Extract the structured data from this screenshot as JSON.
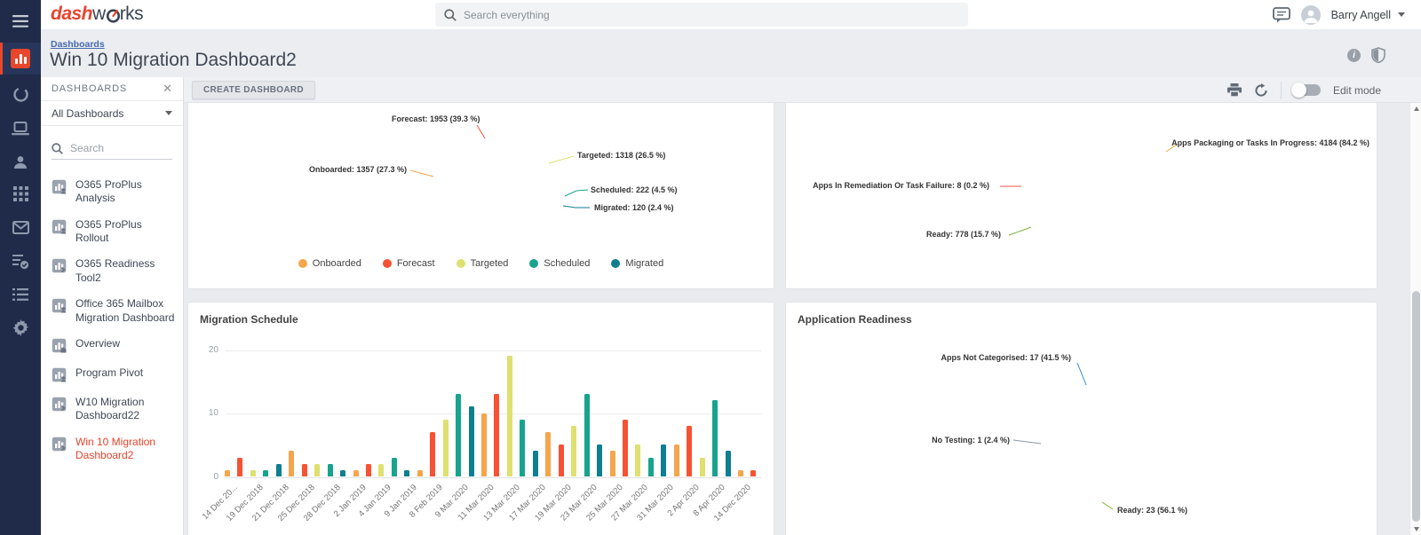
{
  "topbar": {
    "brand_prefix": "dash",
    "brand_mid": "w",
    "brand_suffix": "rks",
    "search_placeholder": "Search everything",
    "user_name": "Barry Angell"
  },
  "header": {
    "breadcrumb": "Dashboards",
    "title": "Win 10 Migration Dashboard2"
  },
  "toolbar": {
    "create_button": "CREATE DASHBOARD",
    "edit_mode_label": "Edit mode"
  },
  "dash_panel": {
    "title": "DASHBOARDS",
    "filter_label": "All Dashboards",
    "search_placeholder": "Search",
    "items": [
      {
        "label": "O365 ProPlus Analysis",
        "icon": "dashboard-user",
        "selected": false
      },
      {
        "label": "O365 ProPlus Rollout",
        "icon": "dashboard-user",
        "selected": false
      },
      {
        "label": "O365 Readiness Tool2",
        "icon": "dashboard-share",
        "selected": false
      },
      {
        "label": "Office 365 Mailbox Migration Dashboard",
        "icon": "dashboard-user",
        "selected": false
      },
      {
        "label": "Overview",
        "icon": "dashboard-home",
        "selected": false
      },
      {
        "label": "Program Pivot",
        "icon": "dashboard-user",
        "selected": false
      },
      {
        "label": "W10 Migration Dashboard22",
        "icon": "dashboard-share",
        "selected": false
      },
      {
        "label": "Win 10 Migration Dashboard2",
        "icon": "dashboard-share",
        "selected": true
      }
    ]
  },
  "chart_data": [
    {
      "type": "donut-semicircle",
      "slices": [
        {
          "name": "Onboarded",
          "value": 1357,
          "pct": 27.3,
          "color": "#F5A54C",
          "label": "Onboarded: 1357 (27.3 %)"
        },
        {
          "name": "Forecast",
          "value": 1953,
          "pct": 39.3,
          "color": "#F75233",
          "label": "Forecast: 1953 (39.3 %)"
        },
        {
          "name": "Targeted",
          "value": 1318,
          "pct": 26.5,
          "color": "#DEE070",
          "label": "Targeted: 1318 (26.5 %)"
        },
        {
          "name": "Scheduled",
          "value": 222,
          "pct": 4.5,
          "color": "#18A38E",
          "label": "Scheduled: 222 (4.5 %)"
        },
        {
          "name": "Migrated",
          "value": 120,
          "pct": 2.4,
          "color": "#0E7E91",
          "label": "Migrated: 120 (2.4 %)"
        }
      ],
      "legend": [
        "Onboarded",
        "Forecast",
        "Targeted",
        "Scheduled",
        "Migrated"
      ],
      "legend_position": "bottom"
    },
    {
      "type": "pie",
      "slices": [
        {
          "name": "Apps Packaging or Tasks In Progress",
          "value": 4184,
          "pct": 84.2,
          "color": "#E9A93C",
          "label": "Apps Packaging or Tasks In Progress: 4184 (84.2 %)",
          "start_deg": 271.1,
          "sweep_deg": 302.8
        },
        {
          "name": "Apps In Remediation Or Task Failure",
          "value": 8,
          "pct": 0.2,
          "color": "#F0564A",
          "label": "Apps In Remediation Or Task Failure: 8 (0.2 %)",
          "start_deg": 270.4,
          "sweep_deg": 0.7
        },
        {
          "name": "Ready",
          "value": 778,
          "pct": 15.7,
          "color": "#76B432",
          "label": "Ready: 778 (15.7 %)",
          "start_deg": 213.9,
          "sweep_deg": 56.5
        }
      ]
    },
    {
      "type": "bar",
      "title": "Migration Schedule",
      "ylim": [
        0,
        20
      ],
      "yticks": [
        0,
        10,
        20
      ],
      "grid": true,
      "palette": [
        "#F5A54C",
        "#F75233",
        "#DEE070",
        "#18A38E",
        "#0E7E91"
      ],
      "x_labels": [
        "14 Dec 20...",
        "19 Dec 2018",
        "21 Dec 2018",
        "25 Dec 2018",
        "28 Dec 2018",
        "2 Jan 2019",
        "4 Jan 2019",
        "9 Jan 2019",
        "8 Feb 2019",
        "9 Mar 2020",
        "11 Mar 2020",
        "13 Mar 2020",
        "17 Mar 2020",
        "19 Mar 2020",
        "23 Mar 2020",
        "25 Mar 2020",
        "27 Mar 2020",
        "31 Mar 2020",
        "2 Apr 2020",
        "8 Apr 2020",
        "14 Dec 2020"
      ],
      "values": [
        1,
        3,
        1,
        1,
        2,
        4,
        2,
        2,
        2,
        1,
        1,
        2,
        2,
        3,
        1,
        1,
        7,
        9,
        13,
        11,
        10,
        13,
        19,
        9,
        4,
        7,
        5,
        8,
        13,
        5,
        4,
        9,
        5,
        3,
        5,
        5,
        8,
        3,
        12,
        4,
        1,
        1
      ]
    },
    {
      "type": "pie",
      "title": "Application Readiness",
      "slices": [
        {
          "name": "Apps Not Categorised",
          "value": 17,
          "pct": 41.5,
          "color": "#3389C0",
          "label": "Apps Not Categorised: 17 (41.5 %)",
          "start_deg": 270.6,
          "sweep_deg": 149.4
        },
        {
          "name": "No Testing",
          "value": 1,
          "pct": 2.4,
          "color": "#8C96A0",
          "label": "No Testing: 1 (2.4 %)",
          "start_deg": 262.0,
          "sweep_deg": 8.6
        },
        {
          "name": "Ready",
          "value": 23,
          "pct": 56.1,
          "color": "#76B432",
          "label": "Ready: 23 (56.1 %)",
          "start_deg": 59.4,
          "sweep_deg": 202.6
        }
      ]
    }
  ]
}
